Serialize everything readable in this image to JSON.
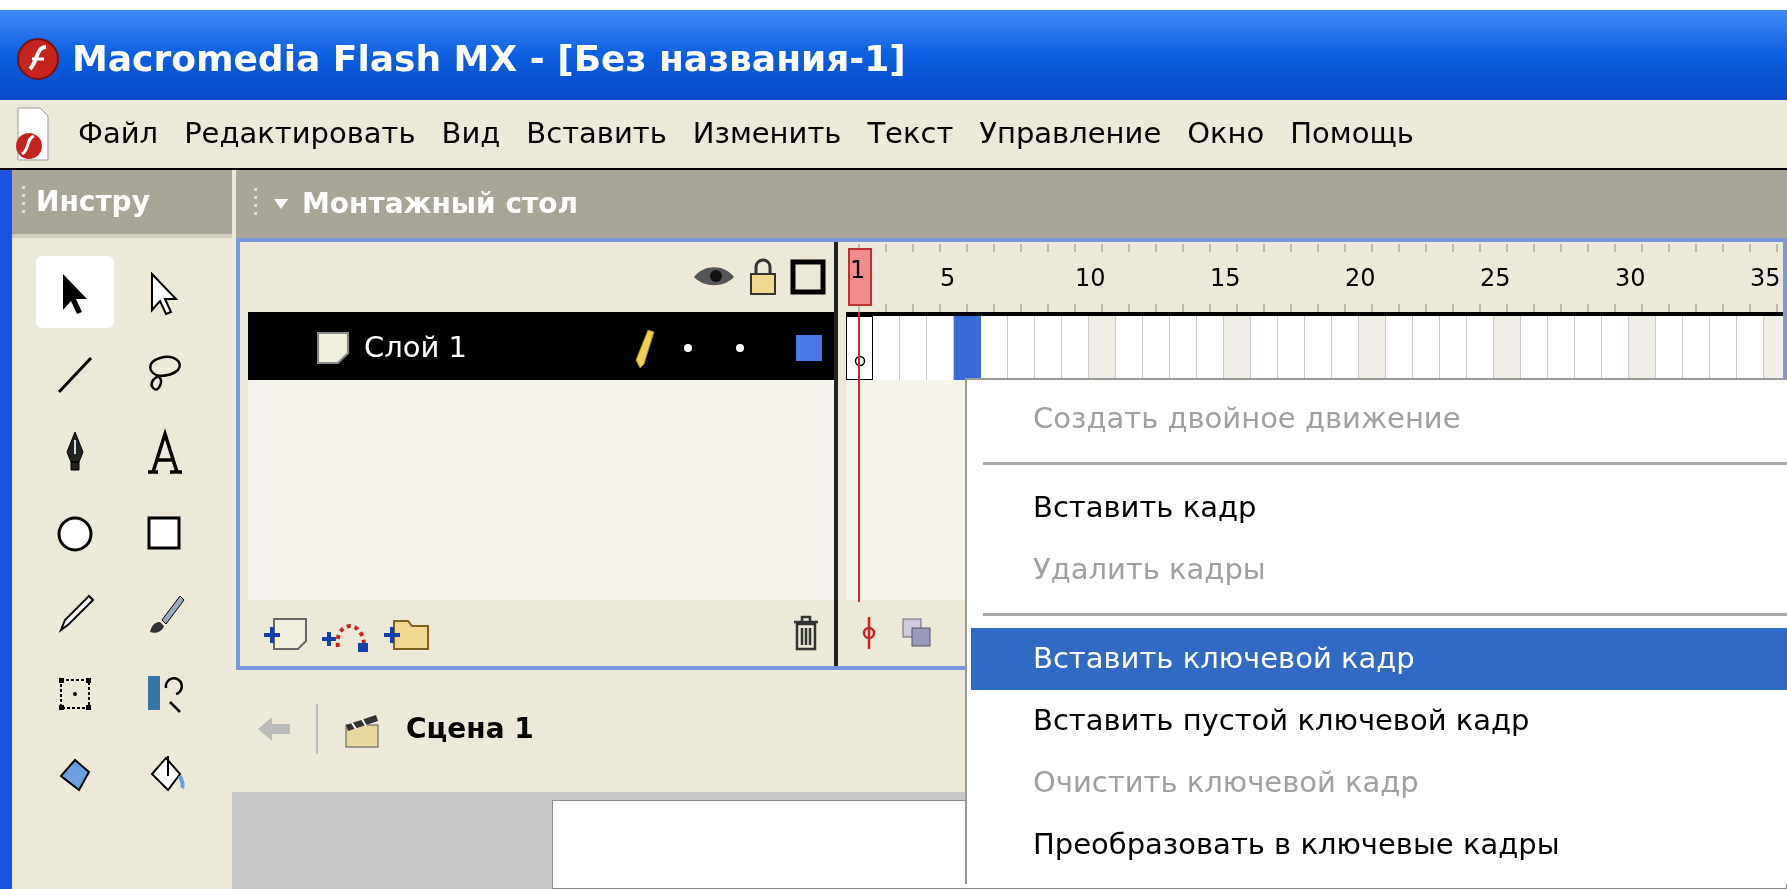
{
  "window": {
    "title": "Macromedia Flash MX - [Без названия-1]"
  },
  "menu": [
    "Файл",
    "Редактировать",
    "Вид",
    "Вставить",
    "Изменить",
    "Текст",
    "Управление",
    "Окно",
    "Помощь"
  ],
  "toolbox": {
    "title": "Инстру",
    "tools": [
      {
        "kind": "arrow",
        "selected": true
      },
      {
        "kind": "subselect",
        "selected": false
      },
      {
        "kind": "line",
        "selected": false
      },
      {
        "kind": "lasso",
        "selected": false
      },
      {
        "kind": "pen",
        "selected": false
      },
      {
        "kind": "text",
        "selected": false
      },
      {
        "kind": "oval",
        "selected": false
      },
      {
        "kind": "rect",
        "selected": false
      },
      {
        "kind": "pencil",
        "selected": false
      },
      {
        "kind": "brush",
        "selected": false
      },
      {
        "kind": "transform",
        "selected": false
      },
      {
        "kind": "filltransform",
        "selected": false
      },
      {
        "kind": "ink",
        "selected": false
      },
      {
        "kind": "bucket",
        "selected": false
      }
    ]
  },
  "timeline": {
    "title": "Монтажный стол",
    "expanded": true,
    "playhead": "1",
    "ruler_labels": [
      "5",
      "10",
      "15",
      "20",
      "25",
      "30",
      "35"
    ],
    "layers": [
      {
        "name": "Слой 1",
        "selected": true,
        "color": "#4a78e8"
      }
    ],
    "frame_cells": [
      {
        "keyframe": true,
        "selected": false
      },
      {
        "keyframe": false,
        "selected": false
      },
      {
        "keyframe": false,
        "selected": false
      },
      {
        "keyframe": false,
        "selected": false
      },
      {
        "keyframe": false,
        "selected": true
      }
    ]
  },
  "scene": {
    "label": "Сцена 1"
  },
  "context_menu": [
    {
      "kind": "item",
      "label": "Создать двойное движение",
      "disabled": true,
      "selected": false
    },
    {
      "kind": "separator"
    },
    {
      "kind": "item",
      "label": "Вставить кадр",
      "disabled": false,
      "selected": false
    },
    {
      "kind": "item",
      "label": "Удалить кадры",
      "disabled": true,
      "selected": false
    },
    {
      "kind": "separator"
    },
    {
      "kind": "item",
      "label": "Вставить ключевой кадр",
      "disabled": false,
      "selected": true
    },
    {
      "kind": "item",
      "label": "Вставить пустой ключевой кадр",
      "disabled": false,
      "selected": false
    },
    {
      "kind": "item",
      "label": "Очистить ключевой кадр",
      "disabled": true,
      "selected": false
    },
    {
      "kind": "item",
      "label": "Преобразовать в ключевые кадры",
      "disabled": false,
      "selected": false
    }
  ]
}
